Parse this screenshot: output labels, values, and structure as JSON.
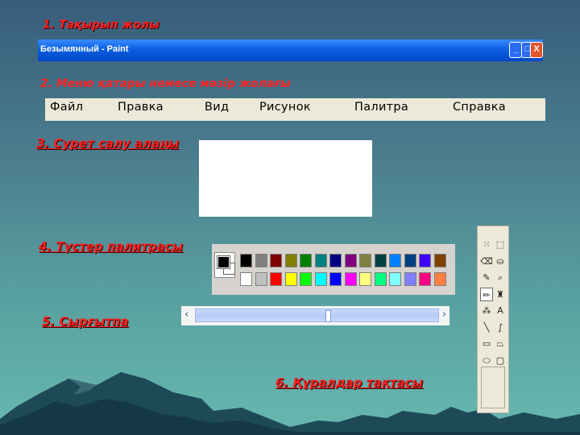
{
  "labels": {
    "title_line": "1. Тақырып жолы",
    "menu_line": "2. Меню қатары немесе мәзір жолағы",
    "drawing_area": "3. Сурет салу алаңы",
    "palette": "4. Түстер палитрасы",
    "scrollbar": "5. Сырғытпа",
    "toolbox": "6. Құралдар тақтасы"
  },
  "window": {
    "title": "Безымянный - Paint",
    "min_glyph": "_",
    "max_glyph": "□",
    "close_glyph": "X"
  },
  "menu": [
    "Файл",
    "Правка",
    "Вид",
    "Рисунок",
    "Палитра",
    "Справка"
  ],
  "palette": {
    "foreground": "#000000",
    "background": "#ffffff",
    "top_row": [
      "#000000",
      "#808080",
      "#800000",
      "#808000",
      "#008000",
      "#008080",
      "#000080",
      "#800080",
      "#808040",
      "#004040",
      "#0080ff",
      "#004080",
      "#4000ff",
      "#804000"
    ],
    "bottom_row": [
      "#ffffff",
      "#c0c0c0",
      "#ff0000",
      "#ffff00",
      "#00ff00",
      "#00ffff",
      "#0000ff",
      "#ff00ff",
      "#ffff80",
      "#00ff80",
      "#80ffff",
      "#8080ff",
      "#ff0080",
      "#ff8040"
    ]
  },
  "scrollbar": {
    "left_arrow": "‹",
    "right_arrow": "›",
    "position": 0.55
  },
  "tools": [
    {
      "name": "free-select-icon",
      "glyph": "⁙"
    },
    {
      "name": "rect-select-icon",
      "glyph": "⬚"
    },
    {
      "name": "eraser-icon",
      "glyph": "⌫"
    },
    {
      "name": "fill-bucket-icon",
      "glyph": "⛀"
    },
    {
      "name": "color-picker-icon",
      "glyph": "✎"
    },
    {
      "name": "magnifier-icon",
      "glyph": "⌕"
    },
    {
      "name": "pencil-icon",
      "glyph": "✏"
    },
    {
      "name": "brush-icon",
      "glyph": "♜"
    },
    {
      "name": "airbrush-icon",
      "glyph": "⁂"
    },
    {
      "name": "text-icon",
      "glyph": "A"
    },
    {
      "name": "line-icon",
      "glyph": "╲"
    },
    {
      "name": "curve-icon",
      "glyph": "∫"
    },
    {
      "name": "rectangle-icon",
      "glyph": "▭"
    },
    {
      "name": "polygon-icon",
      "glyph": "⏢"
    },
    {
      "name": "ellipse-icon",
      "glyph": "⬭"
    },
    {
      "name": "rounded-rect-icon",
      "glyph": "▢"
    }
  ],
  "active_tool": "pencil-icon"
}
